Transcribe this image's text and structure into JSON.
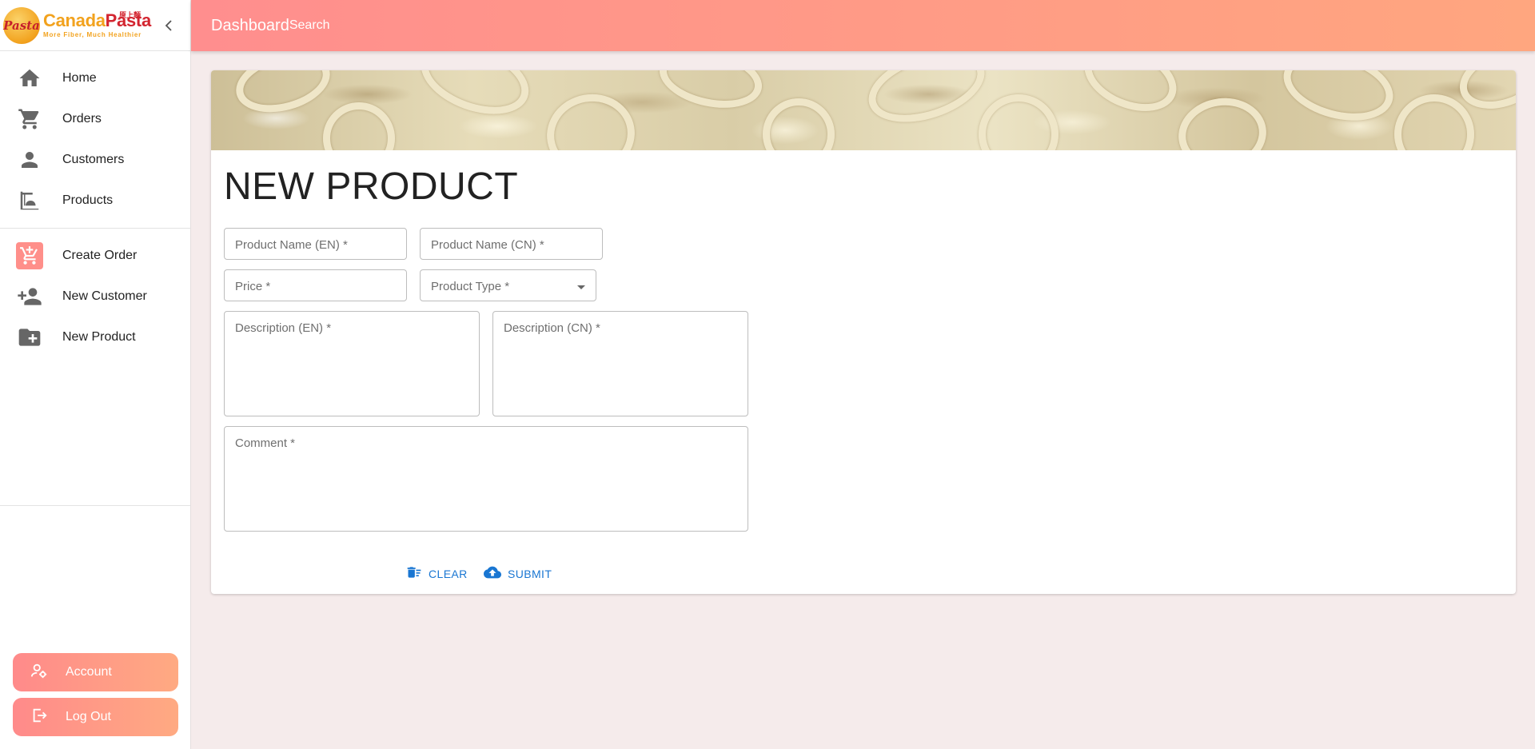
{
  "brand": {
    "name_part1": "Canada",
    "name_part2": "Pasta",
    "tagline": "More Fiber, Much Healthier",
    "badge": "Pasta",
    "chinese": "原上麵"
  },
  "sidebar": {
    "main_items": [
      {
        "label": "Home",
        "icon": "home-icon"
      },
      {
        "label": "Orders",
        "icon": "cart-icon"
      },
      {
        "label": "Customers",
        "icon": "person-icon"
      },
      {
        "label": "Products",
        "icon": "products-icon"
      }
    ],
    "action_items": [
      {
        "label": "Create Order",
        "icon": "add-cart-icon"
      },
      {
        "label": "New Customer",
        "icon": "person-add-icon"
      },
      {
        "label": "New Product",
        "icon": "folder-add-icon"
      }
    ],
    "account_label": "Account",
    "logout_label": "Log Out"
  },
  "topbar": {
    "title": "Dashboard",
    "search": "Search"
  },
  "form": {
    "title": "NEW PRODUCT",
    "product_name_en": "Product Name (EN) *",
    "product_name_cn": "Product Name (CN) *",
    "price": "Price *",
    "product_type": "Product Type *",
    "description_en": "Description (EN) *",
    "description_cn": "Description (CN) *",
    "comment": "Comment *",
    "clear_label": "CLEAR",
    "submit_label": "SUBMIT"
  },
  "colors": {
    "header_gradient_start": "#ff8e8e",
    "header_gradient_end": "#ffa67f",
    "action_blue": "#1976d2",
    "background": "#f5ebeb"
  }
}
